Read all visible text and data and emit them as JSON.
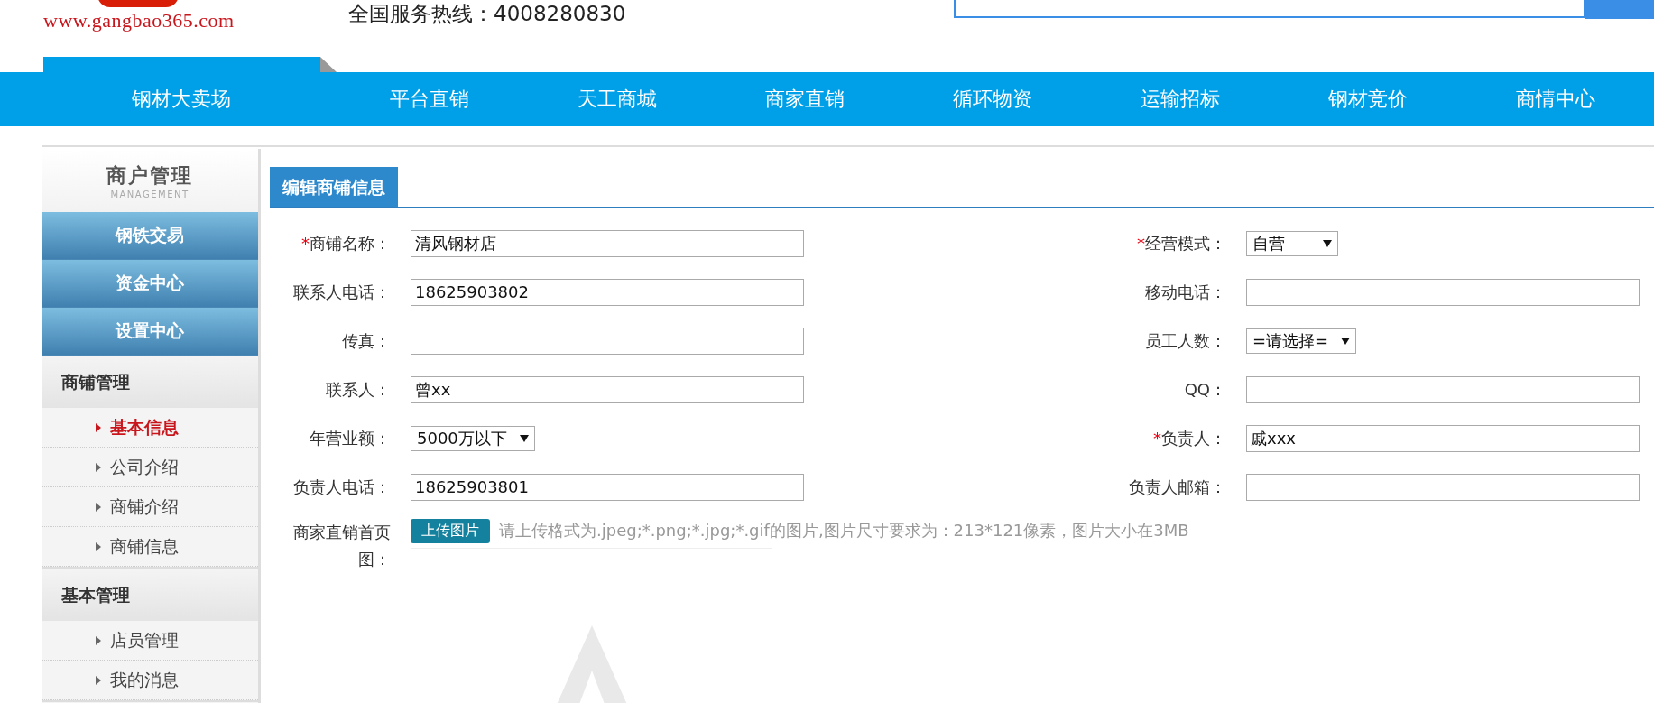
{
  "header": {
    "site_url": "www.gangbao365.com",
    "hotline": "全国服务热线：4008280830"
  },
  "nav": [
    {
      "label": "钢材大卖场"
    },
    {
      "label": "平台直销"
    },
    {
      "label": "天工商城"
    },
    {
      "label": "商家直销"
    },
    {
      "label": "循环物资"
    },
    {
      "label": "运输招标"
    },
    {
      "label": "钢材竞价"
    },
    {
      "label": "商情中心"
    }
  ],
  "sidebar": {
    "title": "商户管理",
    "subtitle": "MANAGEMENT",
    "main_buttons": [
      {
        "label": "钢铁交易"
      },
      {
        "label": "资金中心"
      },
      {
        "label": "设置中心"
      }
    ],
    "sections": [
      {
        "title": "商铺管理",
        "items": [
          {
            "label": "基本信息",
            "selected": true
          },
          {
            "label": "公司介绍",
            "selected": false
          },
          {
            "label": "商铺介绍",
            "selected": false
          },
          {
            "label": "商铺信息",
            "selected": false
          }
        ]
      },
      {
        "title": "基本管理",
        "items": [
          {
            "label": "店员管理",
            "selected": false
          },
          {
            "label": "我的消息",
            "selected": false
          }
        ]
      }
    ]
  },
  "panel": {
    "title": "编辑商铺信息",
    "rows": [
      {
        "left": {
          "required_mark": "*",
          "label": "商铺名称：",
          "kind": "text",
          "value": "清风钢材店"
        },
        "right": {
          "required_mark": "*",
          "label": "经营模式：",
          "kind": "select",
          "value": "自营"
        }
      },
      {
        "left": {
          "label": "联系人电话：",
          "kind": "text",
          "value": "18625903802"
        },
        "right": {
          "label": "移动电话：",
          "kind": "text"
        }
      },
      {
        "left": {
          "label": "传真：",
          "kind": "text"
        },
        "right": {
          "label": "员工人数：",
          "kind": "select",
          "value": "=请选择="
        }
      },
      {
        "left": {
          "label": "联系人：",
          "kind": "text",
          "value": "曾xx"
        },
        "right": {
          "label": "QQ：",
          "kind": "text"
        }
      },
      {
        "left": {
          "label": "年营业额：",
          "kind": "select",
          "value": "5000万以下"
        },
        "right": {
          "required_mark": "*",
          "label": "负责人：",
          "kind": "text",
          "value": "戚xxx"
        }
      },
      {
        "left": {
          "label": "负责人电话：",
          "kind": "text",
          "value": "18625903801"
        },
        "right": {
          "label": "负责人邮箱：",
          "kind": "text"
        }
      }
    ],
    "upload": {
      "label": "商家直销首页图：",
      "button": "上传图片",
      "hint": "请上传格式为.jpeg;*.png;*.jpg;*.gif的图片,图片尺寸要求为：213*121像素，图片大小在3MB"
    }
  }
}
